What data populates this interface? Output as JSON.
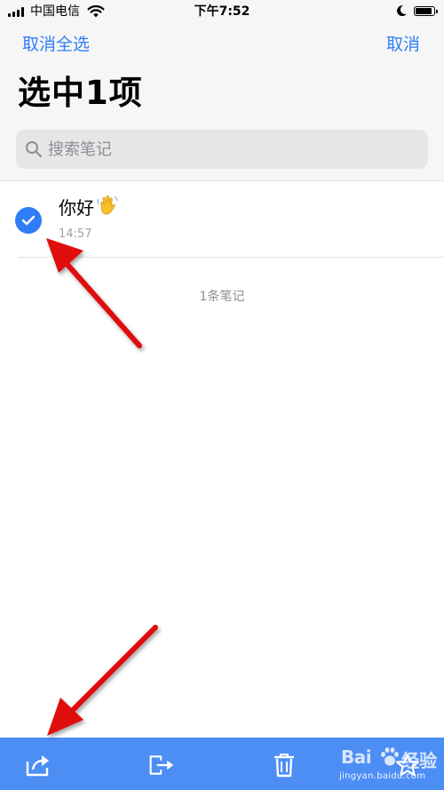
{
  "status_bar": {
    "carrier": "中国电信",
    "time": "下午7:52",
    "icons": [
      "signal-icon",
      "wifi-icon",
      "moon-icon",
      "battery-icon"
    ]
  },
  "nav": {
    "left_label": "取消全选",
    "right_label": "取消"
  },
  "title": "选中1项",
  "search": {
    "placeholder": "搜索笔记",
    "value": ""
  },
  "notes": [
    {
      "title": "你好",
      "emoji": "waving-hand-icon",
      "time": "14:57",
      "selected": true
    }
  ],
  "notes_count": "1条笔记",
  "toolbar": {
    "buttons": [
      "share-icon",
      "move-icon",
      "trash-icon",
      "pin-icon"
    ]
  },
  "watermark": {
    "word_left": "Bai",
    "word_right": "经验",
    "url": "jingyan.baidu.com"
  },
  "colors": {
    "accent": "#2f7df6",
    "toolbar": "#4d8ef5",
    "annotation_arrow": "#e01010"
  }
}
